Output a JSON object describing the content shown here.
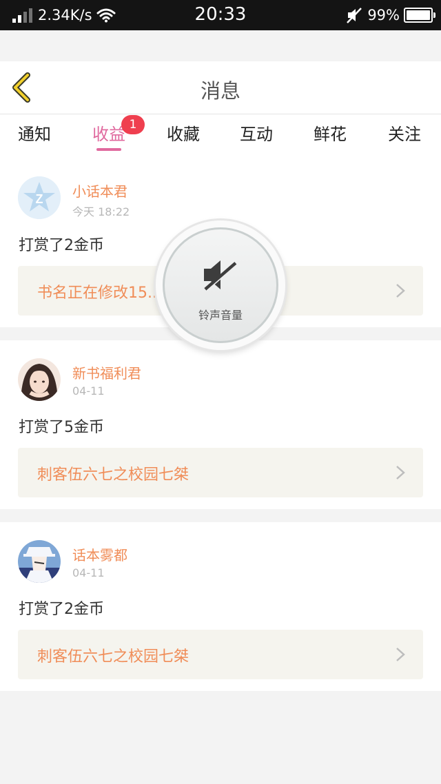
{
  "status_bar": {
    "net_speed": "2.34K/s",
    "time": "20:33",
    "battery_percent": "99%",
    "battery_level": 0.99
  },
  "header": {
    "title": "消息"
  },
  "tabs": [
    {
      "label": "通知",
      "active": false
    },
    {
      "label": "收益",
      "active": true,
      "badge": "1"
    },
    {
      "label": "收藏",
      "active": false
    },
    {
      "label": "互动",
      "active": false
    },
    {
      "label": "鲜花",
      "active": false
    },
    {
      "label": "关注",
      "active": false
    }
  ],
  "messages": [
    {
      "sender": "小话本君",
      "time": "今天 18:22",
      "text": "打赏了2金币",
      "book": "书名正在修改15..."
    },
    {
      "sender": "新书福利君",
      "time": "04-11",
      "text": "打赏了5金币",
      "book": "刺客伍六七之校园七桀"
    },
    {
      "sender": "话本雾都",
      "time": "04-11",
      "text": "打赏了2金币",
      "book": "刺客伍六七之校园七桀"
    }
  ],
  "volume_overlay": {
    "label": "铃声音量",
    "icon": "speaker-muted-icon"
  },
  "colors": {
    "accent_pink": "#e0699e",
    "sender_orange": "#f08d58",
    "badge_red": "#ef3f4f"
  }
}
